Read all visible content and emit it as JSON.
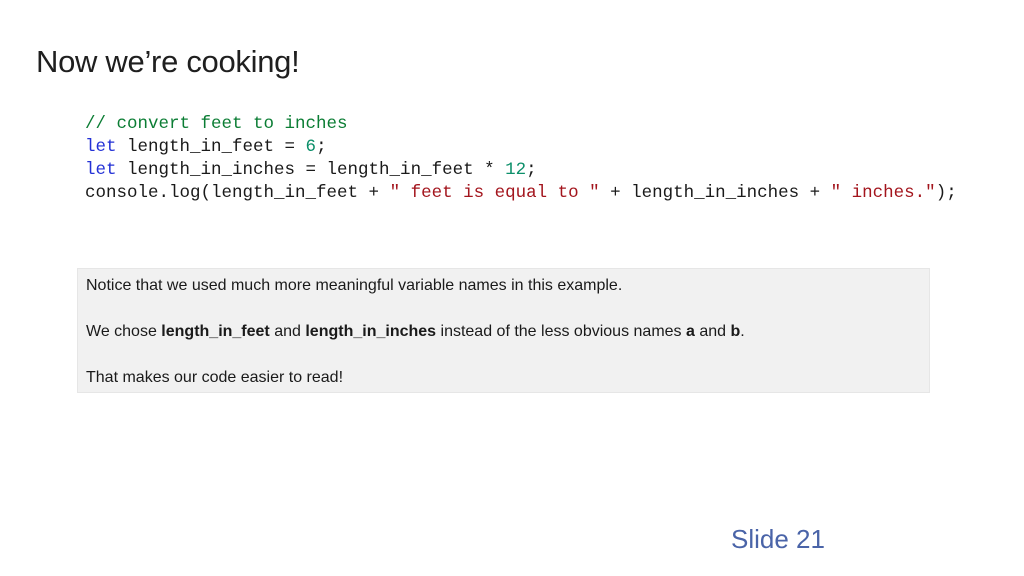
{
  "slide": {
    "title": "Now we’re cooking!",
    "number_label": "Slide 21"
  },
  "code": {
    "comment": "// convert feet to inches",
    "line2": {
      "kw": "let",
      "text": " length_in_feet = ",
      "num": "6",
      "end": ";"
    },
    "line3": {
      "kw": "let",
      "text": " length_in_inches = length_in_feet * ",
      "num": "12",
      "end": ";"
    },
    "line4": {
      "a": "console.log(length_in_feet + ",
      "s1": "\" feet is equal to \"",
      "b": " + length_in_inches + ",
      "s2": "\" inches.\"",
      "c": ");"
    }
  },
  "note": {
    "p1": "Notice that we used much more meaningful variable names in this example.",
    "p2": {
      "t1": "We chose ",
      "b1": "length_in_feet",
      "t2": " and ",
      "b2": "length_in_inches",
      "t3": " instead of the less obvious names ",
      "b3": "a",
      "t4": " and ",
      "b4": "b",
      "t5": "."
    },
    "p3": "That makes our code easier to read!"
  },
  "colors": {
    "comment": "#0b7d34",
    "keyword": "#2331d6",
    "number": "#0c8f6a",
    "string": "#a3151d",
    "slide_number": "#4a64a8",
    "note_background": "#f1f1f1"
  }
}
